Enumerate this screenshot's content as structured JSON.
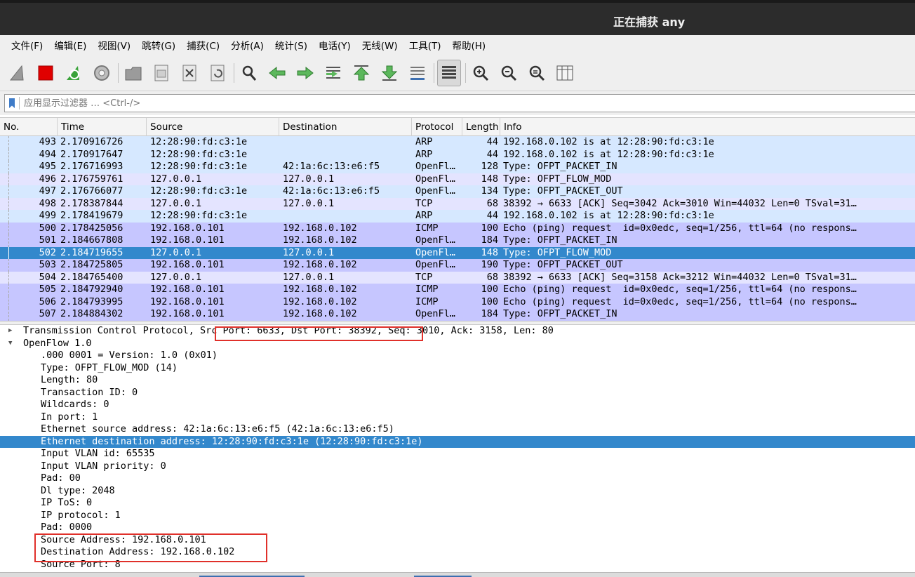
{
  "window": {
    "title": "正在捕获 any"
  },
  "menu": [
    "文件(F)",
    "编辑(E)",
    "视图(V)",
    "跳转(G)",
    "捕获(C)",
    "分析(A)",
    "统计(S)",
    "电话(Y)",
    "无线(W)",
    "工具(T)",
    "帮助(H)"
  ],
  "toolbar": {
    "icons": [
      "shark-fin-start-icon",
      "stop-capture-icon",
      "restart-capture-icon",
      "capture-options-icon",
      "open-file-icon",
      "save-file-icon",
      "close-file-icon",
      "reload-file-icon",
      "find-packet-icon",
      "go-back-icon",
      "go-forward-icon",
      "go-to-packet-icon",
      "go-first-icon",
      "go-last-icon",
      "auto-scroll-icon",
      "colorize-icon",
      "zoom-in-icon",
      "zoom-out-icon",
      "normal-size-icon",
      "resize-columns-icon"
    ]
  },
  "filter": {
    "placeholder": "应用显示过滤器 … <Ctrl-/>"
  },
  "packet_list": {
    "columns": [
      "No.",
      "Time",
      "Source",
      "Destination",
      "Protocol",
      "Length",
      "Info"
    ],
    "rows": [
      {
        "no": "493",
        "time": "2.170916726",
        "src": "12:28:90:fd:c3:1e",
        "dst": "",
        "proto": "ARP",
        "len": "44",
        "info": "192.168.0.102 is at 12:28:90:fd:c3:1e",
        "color": "#d6e8ff"
      },
      {
        "no": "494",
        "time": "2.170917647",
        "src": "12:28:90:fd:c3:1e",
        "dst": "",
        "proto": "ARP",
        "len": "44",
        "info": "192.168.0.102 is at 12:28:90:fd:c3:1e",
        "color": "#d6e8ff"
      },
      {
        "no": "495",
        "time": "2.176716993",
        "src": "12:28:90:fd:c3:1e",
        "dst": "42:1a:6c:13:e6:f5",
        "proto": "OpenFl…",
        "len": "128",
        "info": "Type: OFPT_PACKET_IN",
        "color": "#d6e8ff"
      },
      {
        "no": "496",
        "time": "2.176759761",
        "src": "127.0.0.1",
        "dst": "127.0.0.1",
        "proto": "OpenFl…",
        "len": "148",
        "info": "Type: OFPT_FLOW_MOD",
        "color": "#e4e4ff"
      },
      {
        "no": "497",
        "time": "2.176766077",
        "src": "12:28:90:fd:c3:1e",
        "dst": "42:1a:6c:13:e6:f5",
        "proto": "OpenFl…",
        "len": "134",
        "info": "Type: OFPT_PACKET_OUT",
        "color": "#d6e8ff"
      },
      {
        "no": "498",
        "time": "2.178387844",
        "src": "127.0.0.1",
        "dst": "127.0.0.1",
        "proto": "TCP",
        "len": "68",
        "info": "38392 → 6633 [ACK] Seq=3042 Ack=3010 Win=44032 Len=0 TSval=31…",
        "color": "#e4e4ff"
      },
      {
        "no": "499",
        "time": "2.178419679",
        "src": "12:28:90:fd:c3:1e",
        "dst": "",
        "proto": "ARP",
        "len": "44",
        "info": "192.168.0.102 is at 12:28:90:fd:c3:1e",
        "color": "#d6e8ff"
      },
      {
        "no": "500",
        "time": "2.178425056",
        "src": "192.168.0.101",
        "dst": "192.168.0.102",
        "proto": "ICMP",
        "len": "100",
        "info": "Echo (ping) request  id=0x0edc, seq=1/256, ttl=64 (no respons…",
        "color": "#c6c6ff"
      },
      {
        "no": "501",
        "time": "2.184667808",
        "src": "192.168.0.101",
        "dst": "192.168.0.102",
        "proto": "OpenFl…",
        "len": "184",
        "info": "Type: OFPT_PACKET_IN",
        "color": "#c6c6ff"
      },
      {
        "no": "502",
        "time": "2.184719655",
        "src": "127.0.0.1",
        "dst": "127.0.0.1",
        "proto": "OpenFl…",
        "len": "148",
        "info": "Type: OFPT_FLOW_MOD",
        "color": "#3388cc",
        "selected": true
      },
      {
        "no": "503",
        "time": "2.184725805",
        "src": "192.168.0.101",
        "dst": "192.168.0.102",
        "proto": "OpenFl…",
        "len": "190",
        "info": "Type: OFPT_PACKET_OUT",
        "color": "#c6c6ff"
      },
      {
        "no": "504",
        "time": "2.184765400",
        "src": "127.0.0.1",
        "dst": "127.0.0.1",
        "proto": "TCP",
        "len": "68",
        "info": "38392 → 6633 [ACK] Seq=3158 Ack=3212 Win=44032 Len=0 TSval=31…",
        "color": "#e4e4ff"
      },
      {
        "no": "505",
        "time": "2.184792940",
        "src": "192.168.0.101",
        "dst": "192.168.0.102",
        "proto": "ICMP",
        "len": "100",
        "info": "Echo (ping) request  id=0x0edc, seq=1/256, ttl=64 (no respons…",
        "color": "#c6c6ff"
      },
      {
        "no": "506",
        "time": "2.184793995",
        "src": "192.168.0.101",
        "dst": "192.168.0.102",
        "proto": "ICMP",
        "len": "100",
        "info": "Echo (ping) request  id=0x0edc, seq=1/256, ttl=64 (no respons…",
        "color": "#c6c6ff"
      },
      {
        "no": "507",
        "time": "2.184884302",
        "src": "192.168.0.101",
        "dst": "192.168.0.102",
        "proto": "OpenFl…",
        "len": "184",
        "info": "Type: OFPT_PACKET_IN",
        "color": "#c6c6ff"
      }
    ]
  },
  "details": {
    "rows": [
      {
        "arrow": "collapsed",
        "indent": 0,
        "text": "Transmission Control Protocol, Src Port: 6633, Dst Port: 38392, Seq: 3010, Ack: 3158, Len: 80"
      },
      {
        "arrow": "expanded",
        "indent": 0,
        "text": "OpenFlow 1.0"
      },
      {
        "arrow": "none",
        "indent": 1,
        "text": ".000 0001 = Version: 1.0 (0x01)"
      },
      {
        "arrow": "none",
        "indent": 1,
        "text": "Type: OFPT_FLOW_MOD (14)"
      },
      {
        "arrow": "none",
        "indent": 1,
        "text": "Length: 80"
      },
      {
        "arrow": "none",
        "indent": 1,
        "text": "Transaction ID: 0"
      },
      {
        "arrow": "none",
        "indent": 1,
        "text": "Wildcards: 0"
      },
      {
        "arrow": "none",
        "indent": 1,
        "text": "In port: 1"
      },
      {
        "arrow": "none",
        "indent": 1,
        "text": "Ethernet source address: 42:1a:6c:13:e6:f5 (42:1a:6c:13:e6:f5)"
      },
      {
        "arrow": "none",
        "indent": 1,
        "text": "Ethernet destination address: 12:28:90:fd:c3:1e (12:28:90:fd:c3:1e)",
        "selected": true
      },
      {
        "arrow": "none",
        "indent": 1,
        "text": "Input VLAN id: 65535"
      },
      {
        "arrow": "none",
        "indent": 1,
        "text": "Input VLAN priority: 0"
      },
      {
        "arrow": "none",
        "indent": 1,
        "text": "Pad: 00"
      },
      {
        "arrow": "none",
        "indent": 1,
        "text": "Dl type: 2048"
      },
      {
        "arrow": "none",
        "indent": 1,
        "text": "IP ToS: 0"
      },
      {
        "arrow": "none",
        "indent": 1,
        "text": "IP protocol: 1"
      },
      {
        "arrow": "none",
        "indent": 1,
        "text": "Pad: 0000"
      },
      {
        "arrow": "none",
        "indent": 1,
        "text": "Source Address: 192.168.0.101"
      },
      {
        "arrow": "none",
        "indent": 1,
        "text": "Destination Address: 192.168.0.102"
      },
      {
        "arrow": "none",
        "indent": 1,
        "text": "Source Port: 8"
      }
    ]
  },
  "colors": {
    "selection": "#3388cc",
    "highlight_box": "#e0302a"
  }
}
